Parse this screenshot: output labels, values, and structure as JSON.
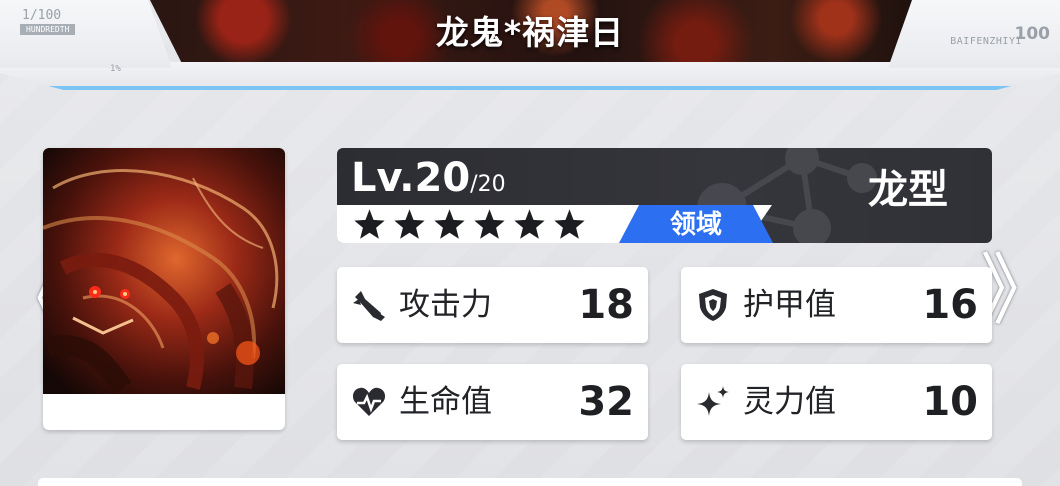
{
  "header": {
    "title": "龙鬼*祸津日",
    "corner_left": {
      "count": "1/100",
      "tag": "HUNDREDTH",
      "percent": "1%"
    },
    "corner_right": {
      "brand": "BAIFENZHIYI",
      "number": "100"
    }
  },
  "card": {
    "level_prefix": "Lv.20",
    "level_max": "/20",
    "stars": 6,
    "domain_label": "领域",
    "race": "龙型"
  },
  "stats": {
    "attack": {
      "label": "攻击力",
      "value": "18",
      "icon": "sword-icon"
    },
    "armor": {
      "label": "护甲值",
      "value": "16",
      "icon": "shield-icon"
    },
    "health": {
      "label": "生命值",
      "value": "32",
      "icon": "heartbeat-icon"
    },
    "spirit": {
      "label": "灵力值",
      "value": "10",
      "icon": "sparkle-icon"
    }
  },
  "nav": {
    "prev": "《",
    "next": "》"
  },
  "colors": {
    "accent_blue": "#2c6ff0",
    "frame_blue": "#7cc4f4",
    "panel_dark": "#2c2d32"
  }
}
